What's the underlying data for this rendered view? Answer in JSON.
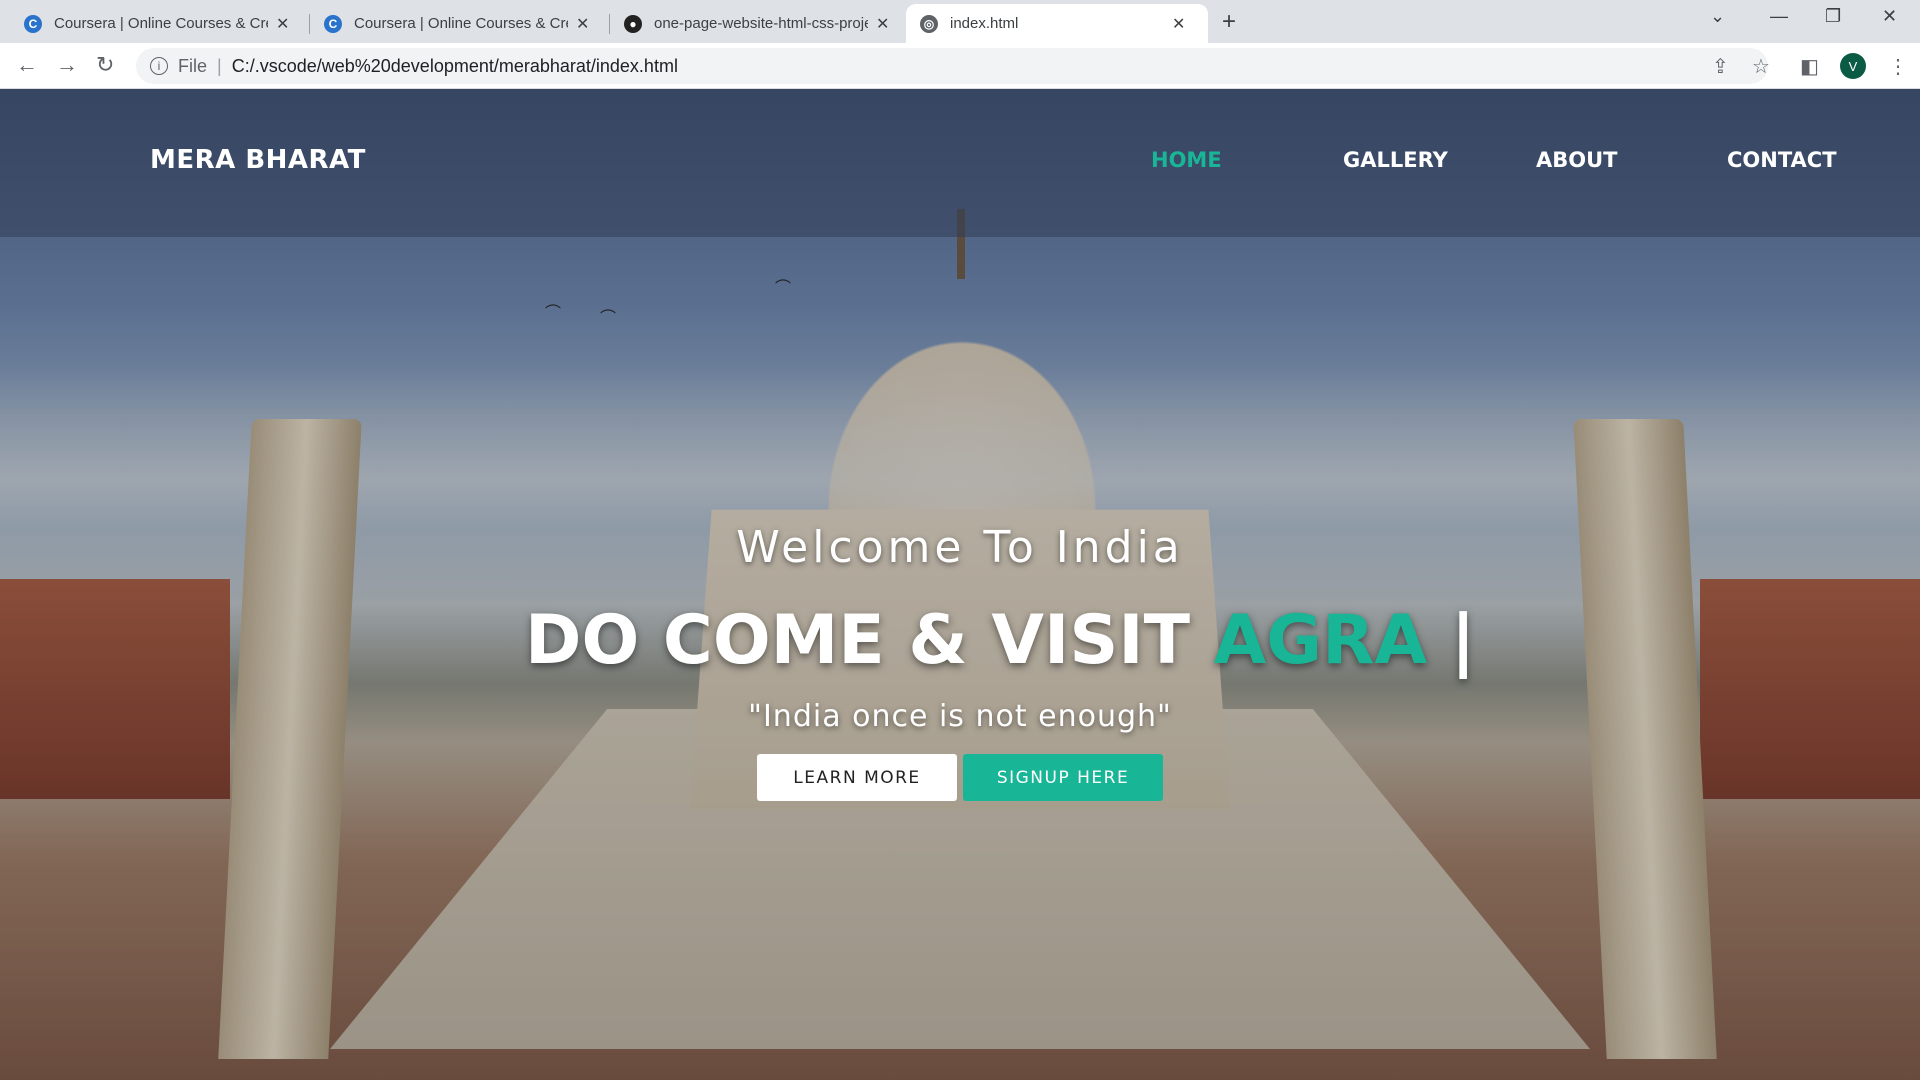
{
  "browser": {
    "tabs": [
      {
        "title": "Coursera | Online Courses & Credentials",
        "favicon": "coursera-icon"
      },
      {
        "title": "Coursera | Online Courses & Credentials",
        "favicon": "coursera-icon"
      },
      {
        "title": "one-page-website-html-css-project",
        "favicon": "github-icon"
      },
      {
        "title": "index.html",
        "favicon": "globe-icon",
        "active": true
      }
    ],
    "new_tab_label": "+",
    "address": {
      "scheme": "File",
      "url": "C:/.vscode/web%20development/merabharat/index.html"
    },
    "profile_initial": "V"
  },
  "site": {
    "brand": "MERA BHARAT",
    "nav": [
      {
        "label": "HOME",
        "active": true
      },
      {
        "label": "GALLERY"
      },
      {
        "label": "ABOUT"
      },
      {
        "label": "CONTACT"
      }
    ],
    "hero": {
      "subtitle": "Welcome To India",
      "title_main": "DO COME & VISIT ",
      "title_accent": "AGRA",
      "title_cursor": " |",
      "quote": "\"India once is not enough\"",
      "learn_button": "LEARN MORE",
      "signup_button": "SIGNUP HERE"
    }
  },
  "colors": {
    "accent": "#18b596",
    "nav_overlay": "#323e58"
  }
}
